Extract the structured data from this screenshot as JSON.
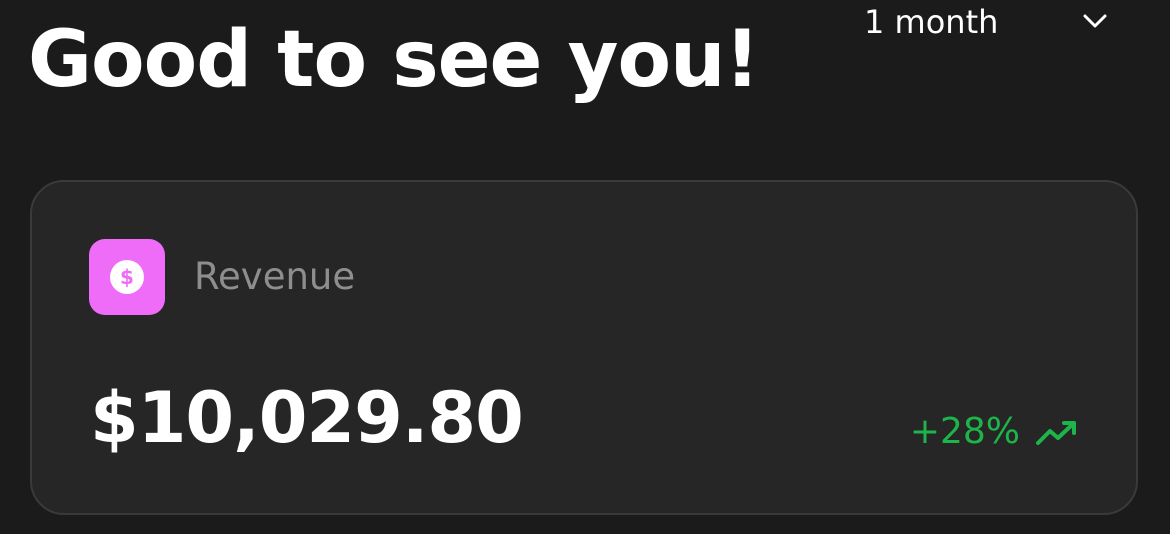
{
  "header": {
    "greeting": "Good to see you!",
    "period_selected": "1 month"
  },
  "card": {
    "title": "Revenue",
    "value": "$10,029.80",
    "change": "+28%",
    "icon": "dollar-circle-icon",
    "trend_icon": "trending-up-icon"
  },
  "colors": {
    "background": "#1b1b1b",
    "card_background": "#262626",
    "card_border": "#3a3a3a",
    "icon_background": "#ef6cf8",
    "trend_positive": "#1db54a",
    "muted_text": "#8e8e8e"
  }
}
